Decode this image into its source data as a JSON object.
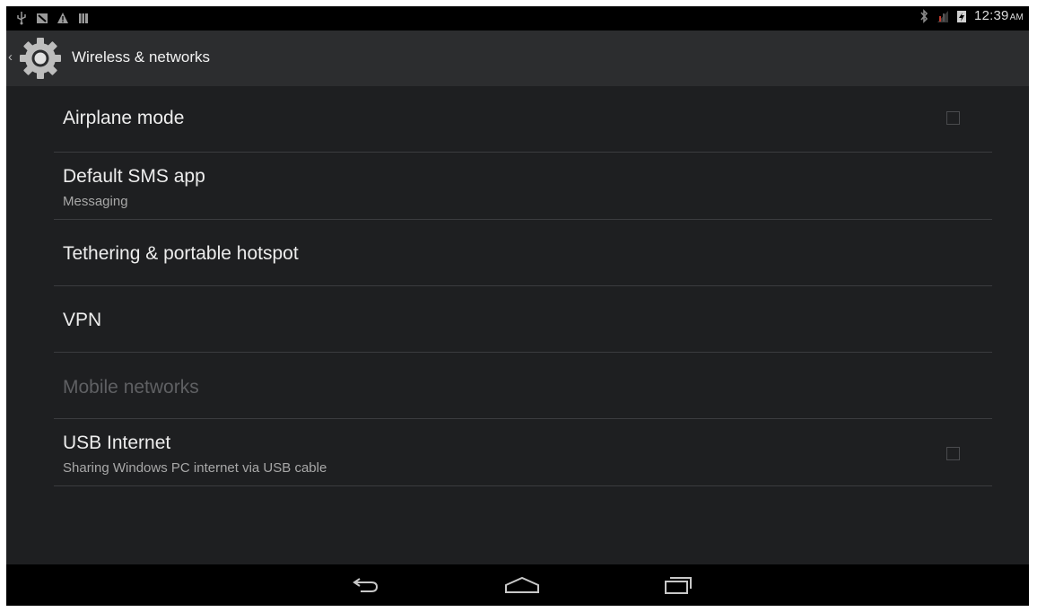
{
  "status_bar": {
    "time": "12:39",
    "ampm": "AM",
    "left_icons": [
      "usb-icon",
      "notification-icon",
      "warning-icon",
      "storage-icon"
    ],
    "right_icons": [
      "bluetooth-icon",
      "no-signal-icon",
      "battery-charging-icon"
    ]
  },
  "action_bar": {
    "title": "Wireless & networks",
    "icon": "settings-gear-icon"
  },
  "settings": [
    {
      "title": "Airplane mode",
      "subtitle": "",
      "checkbox": true,
      "checked": false,
      "enabled": true
    },
    {
      "title": "Default SMS app",
      "subtitle": "Messaging",
      "checkbox": false,
      "enabled": true
    },
    {
      "title": "Tethering & portable hotspot",
      "subtitle": "",
      "checkbox": false,
      "enabled": true
    },
    {
      "title": "VPN",
      "subtitle": "",
      "checkbox": false,
      "enabled": true
    },
    {
      "title": "Mobile networks",
      "subtitle": "",
      "checkbox": false,
      "enabled": false
    },
    {
      "title": "USB Internet",
      "subtitle": "Sharing Windows PC internet via USB cable",
      "checkbox": true,
      "checked": false,
      "enabled": true
    }
  ],
  "nav_bar": {
    "buttons": [
      "back-icon",
      "home-icon",
      "recent-apps-icon"
    ]
  },
  "colors": {
    "background": "#1e1f21",
    "action_bar": "#2c2d2f",
    "divider": "#3b3c3f",
    "primary_text": "#ededed",
    "secondary_text": "#a8a8a8",
    "disabled_text": "#5f6063"
  }
}
